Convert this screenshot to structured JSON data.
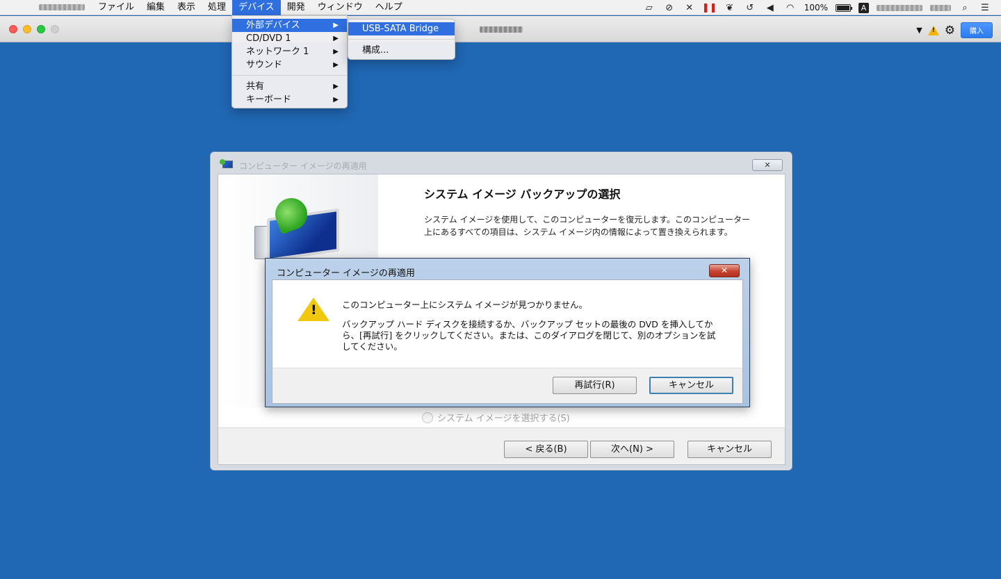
{
  "menubar": {
    "menus": [
      "ファイル",
      "編集",
      "表示",
      "処理",
      "デバイス",
      "開発",
      "ウィンドウ",
      "ヘルプ"
    ],
    "active_menu": "デバイス",
    "battery": "100%",
    "input_source": "A"
  },
  "toolbar": {
    "buy_label": "購入"
  },
  "device_menu": {
    "items": [
      {
        "label": "外部デバイス"
      },
      {
        "label": "CD/DVD 1"
      },
      {
        "label": "ネットワーク 1"
      },
      {
        "label": "サウンド"
      },
      {
        "label": "共有"
      },
      {
        "label": "キーボード"
      }
    ]
  },
  "submenu": {
    "items": [
      {
        "label": "USB-SATA Bridge"
      },
      {
        "label": "構成..."
      }
    ]
  },
  "wizard": {
    "title": "コンピューター イメージの再適用",
    "close": "✕",
    "heading": "システム イメージ バックアップの選択",
    "description": "システム イメージを使用して、このコンピューターを復元します。このコンピューター上にあるすべての項目は、システム イメージ内の情報によって置き換えられます。",
    "radio_label": "システム イメージを選択する(S)",
    "back_label": "< 戻る(B)",
    "next_label": "次へ(N) >",
    "cancel_label": "キャンセル"
  },
  "error_dialog": {
    "title": "コンピューター イメージの再適用",
    "close": "✕",
    "message1": "このコンピューター上にシステム イメージが見つかりません。",
    "message2": "バックアップ ハード ディスクを接続するか、バックアップ セットの最後の DVD を挿入してから、[再試行] をクリックしてください。または、このダイアログを閉じて、別のオプションを試してください。",
    "retry_label": "再試行(R)",
    "cancel_label": "キャンセル"
  }
}
